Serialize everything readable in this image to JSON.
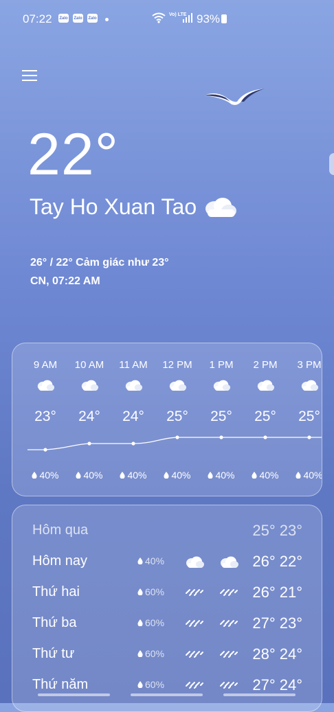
{
  "status": {
    "time": "07:22",
    "apps": [
      "Zalo",
      "Zalo",
      "Zalo"
    ],
    "volte": "Vo) LTE",
    "battery": "93%"
  },
  "current": {
    "temp": "22°",
    "location": "Tay Ho Xuan Tao",
    "high_low_feels": "26° / 22° Cảm giác như 23°",
    "datetime": "CN, 07:22 AM"
  },
  "hourly": [
    {
      "time": "9 AM",
      "temp": "23°",
      "precip": "40%",
      "t": 23
    },
    {
      "time": "10 AM",
      "temp": "24°",
      "precip": "40%",
      "t": 24
    },
    {
      "time": "11 AM",
      "temp": "24°",
      "precip": "40%",
      "t": 24
    },
    {
      "time": "12 PM",
      "temp": "25°",
      "precip": "40%",
      "t": 25
    },
    {
      "time": "1 PM",
      "temp": "25°",
      "precip": "40%",
      "t": 25
    },
    {
      "time": "2 PM",
      "temp": "25°",
      "precip": "40%",
      "t": 25
    },
    {
      "time": "3 PM",
      "temp": "25°",
      "precip": "40%",
      "t": 25
    }
  ],
  "daily": [
    {
      "day": "Hôm qua",
      "precip": "",
      "temps": "25° 23°",
      "icon1": "",
      "icon2": ""
    },
    {
      "day": "Hôm nay",
      "precip": "40%",
      "temps": "26° 22°",
      "icon1": "cloud-icon",
      "icon2": "cloud-icon"
    },
    {
      "day": "Thứ hai",
      "precip": "60%",
      "temps": "26° 21°",
      "icon1": "rain-icon",
      "icon2": "rain-icon"
    },
    {
      "day": "Thứ ba",
      "precip": "60%",
      "temps": "27° 23°",
      "icon1": "rain-icon",
      "icon2": "rain-icon"
    },
    {
      "day": "Thứ tư",
      "precip": "60%",
      "temps": "28° 24°",
      "icon1": "rain-icon",
      "icon2": "rain-icon"
    },
    {
      "day": "Thứ năm",
      "precip": "60%",
      "temps": "27° 24°",
      "icon1": "rain-icon",
      "icon2": "rain-icon"
    }
  ]
}
